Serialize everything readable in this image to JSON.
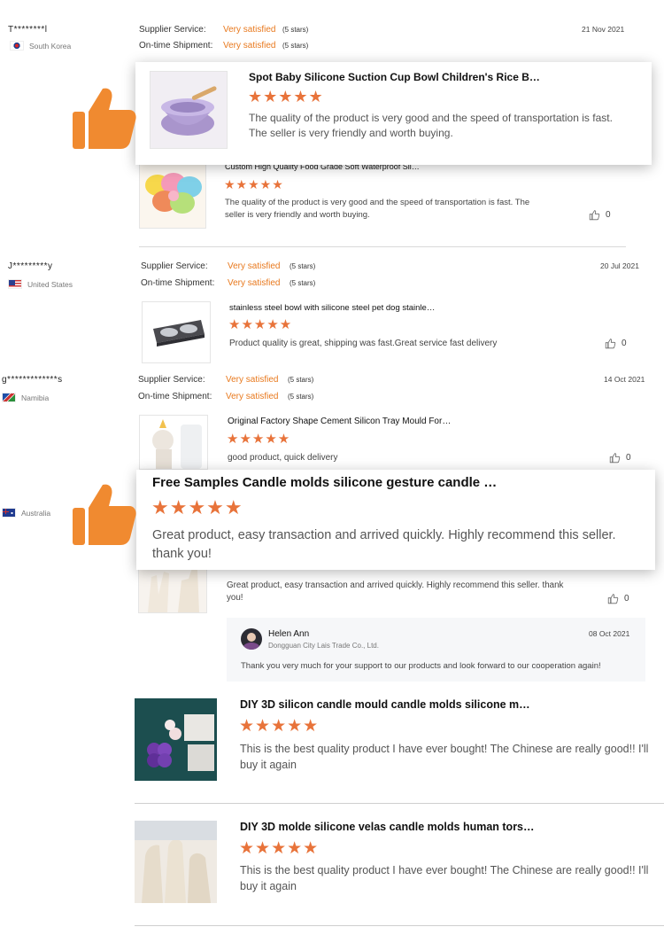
{
  "labels": {
    "supplier_service": "Supplier Service:",
    "ontime_shipment": "On-time Shipment:",
    "very_satisfied": "Very satisfied",
    "five_stars": "(5 stars)"
  },
  "reviews": [
    {
      "name": "T********l",
      "country": "South Korea",
      "date": "21 Nov 2021",
      "product": "Custom High Quality Food Grade Soft Waterproof Sil…",
      "text": "The quality of the product is very good and the speed of transportation is fast. The seller is very friendly and worth buying.",
      "likes": "0"
    },
    {
      "name": "J*********y",
      "country": "United States",
      "date": "20 Jul 2021",
      "product": "stainless steel bowl with silicone steel pet dog stainle…",
      "text": "Product quality is great, shipping was fast.Great service fast delivery",
      "likes": "0"
    },
    {
      "name": "g*************s",
      "country": "Namibia",
      "date": "14 Oct 2021",
      "product": "Original Factory Shape Cement Silicon Tray Mould For…",
      "text": "good product, quick delivery",
      "likes": "0"
    },
    {
      "country": "Australia",
      "text": "Great product, easy transaction and arrived quickly.  Highly recommend this seller.  thank you!",
      "likes": "0"
    }
  ],
  "popups": [
    {
      "product": "Spot Baby Silicone Suction Cup Bowl Children's Rice B…",
      "text": "The quality of the product is very good and the speed of transportation is fast. The seller is very friendly and worth buying."
    },
    {
      "product": "Free Samples Candle molds silicone gesture candle …",
      "text": "Great product, easy transaction and arrived quickly.  Highly recommend this seller.  thank you!"
    }
  ],
  "reply": {
    "name": "Helen Ann",
    "company": "Dongguan City Lais Trade Co., Ltd.",
    "date": "08 Oct 2021",
    "text": "Thank you very much for your support to our products and look forward to our cooperation again!"
  },
  "bottom_reviews": [
    {
      "product": "DIY 3D silicon candle mould candle molds silicone m…",
      "text": "This is the best quality product I have ever bought! The Chinese are really good!! I'll buy it again"
    },
    {
      "product": "DIY 3D molde silicone velas candle molds human tors…",
      "text": "This is the best quality product I have ever bought! The Chinese are really good!! I'll buy it again"
    }
  ],
  "stars": "★★★★★",
  "colors": {
    "accent": "#e8791e",
    "star": "#e8733a",
    "thumb": "#f08a30"
  },
  "icons": {
    "like": "thumbs-up-icon",
    "big_thumb": "thumbs-up-icon"
  }
}
